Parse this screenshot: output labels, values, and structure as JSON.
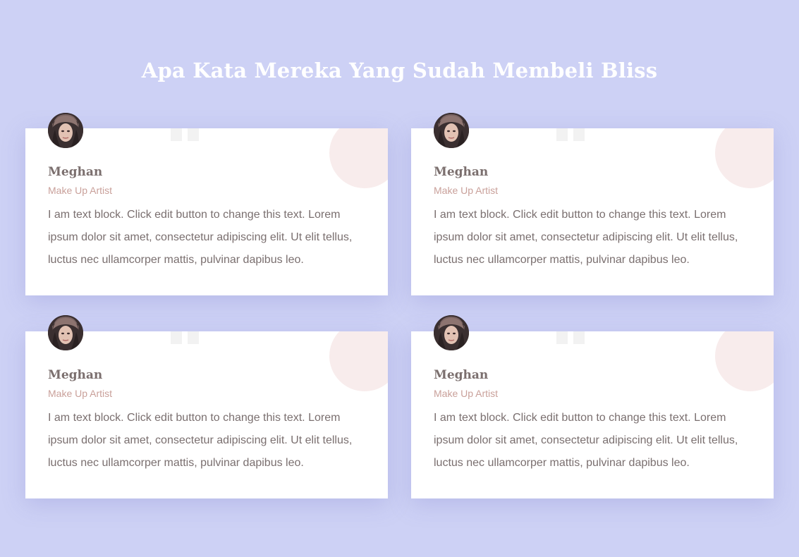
{
  "section": {
    "title": "Apa Kata Mereka Yang Sudah Membeli Bliss"
  },
  "testimonials": [
    {
      "name": "Meghan",
      "role": "Make Up Artist",
      "text": "I am text block. Click edit button to change this text. Lorem ipsum dolor sit amet, consectetur adipiscing elit. Ut elit tellus, luctus nec ullamcorper mattis, pulvinar dapibus leo.",
      "avatar_icon": "avatar-photo"
    },
    {
      "name": "Meghan",
      "role": "Make Up Artist",
      "text": "I am text block. Click edit button to change this text. Lorem ipsum dolor sit amet, consectetur adipiscing elit. Ut elit tellus, luctus nec ullamcorper mattis, pulvinar dapibus leo.",
      "avatar_icon": "avatar-photo"
    },
    {
      "name": "Meghan",
      "role": "Make Up Artist",
      "text": "I am text block. Click edit button to change this text. Lorem ipsum dolor sit amet, consectetur adipiscing elit. Ut elit tellus, luctus nec ullamcorper mattis, pulvinar dapibus leo.",
      "avatar_icon": "avatar-photo"
    },
    {
      "name": "Meghan",
      "role": "Make Up Artist",
      "text": "I am text block. Click edit button to change this text. Lorem ipsum dolor sit amet, consectetur adipiscing elit. Ut elit tellus, luctus nec ullamcorper mattis, pulvinar dapibus leo.",
      "avatar_icon": "avatar-photo"
    }
  ],
  "colors": {
    "background": "#cdd1f5",
    "card": "#ffffff",
    "accent_circle": "#f8ecec",
    "name": "#7b6f6e",
    "role": "#c9a09a",
    "body_text": "#7a6f6f"
  },
  "icons": {
    "quote": "quote-icon"
  }
}
